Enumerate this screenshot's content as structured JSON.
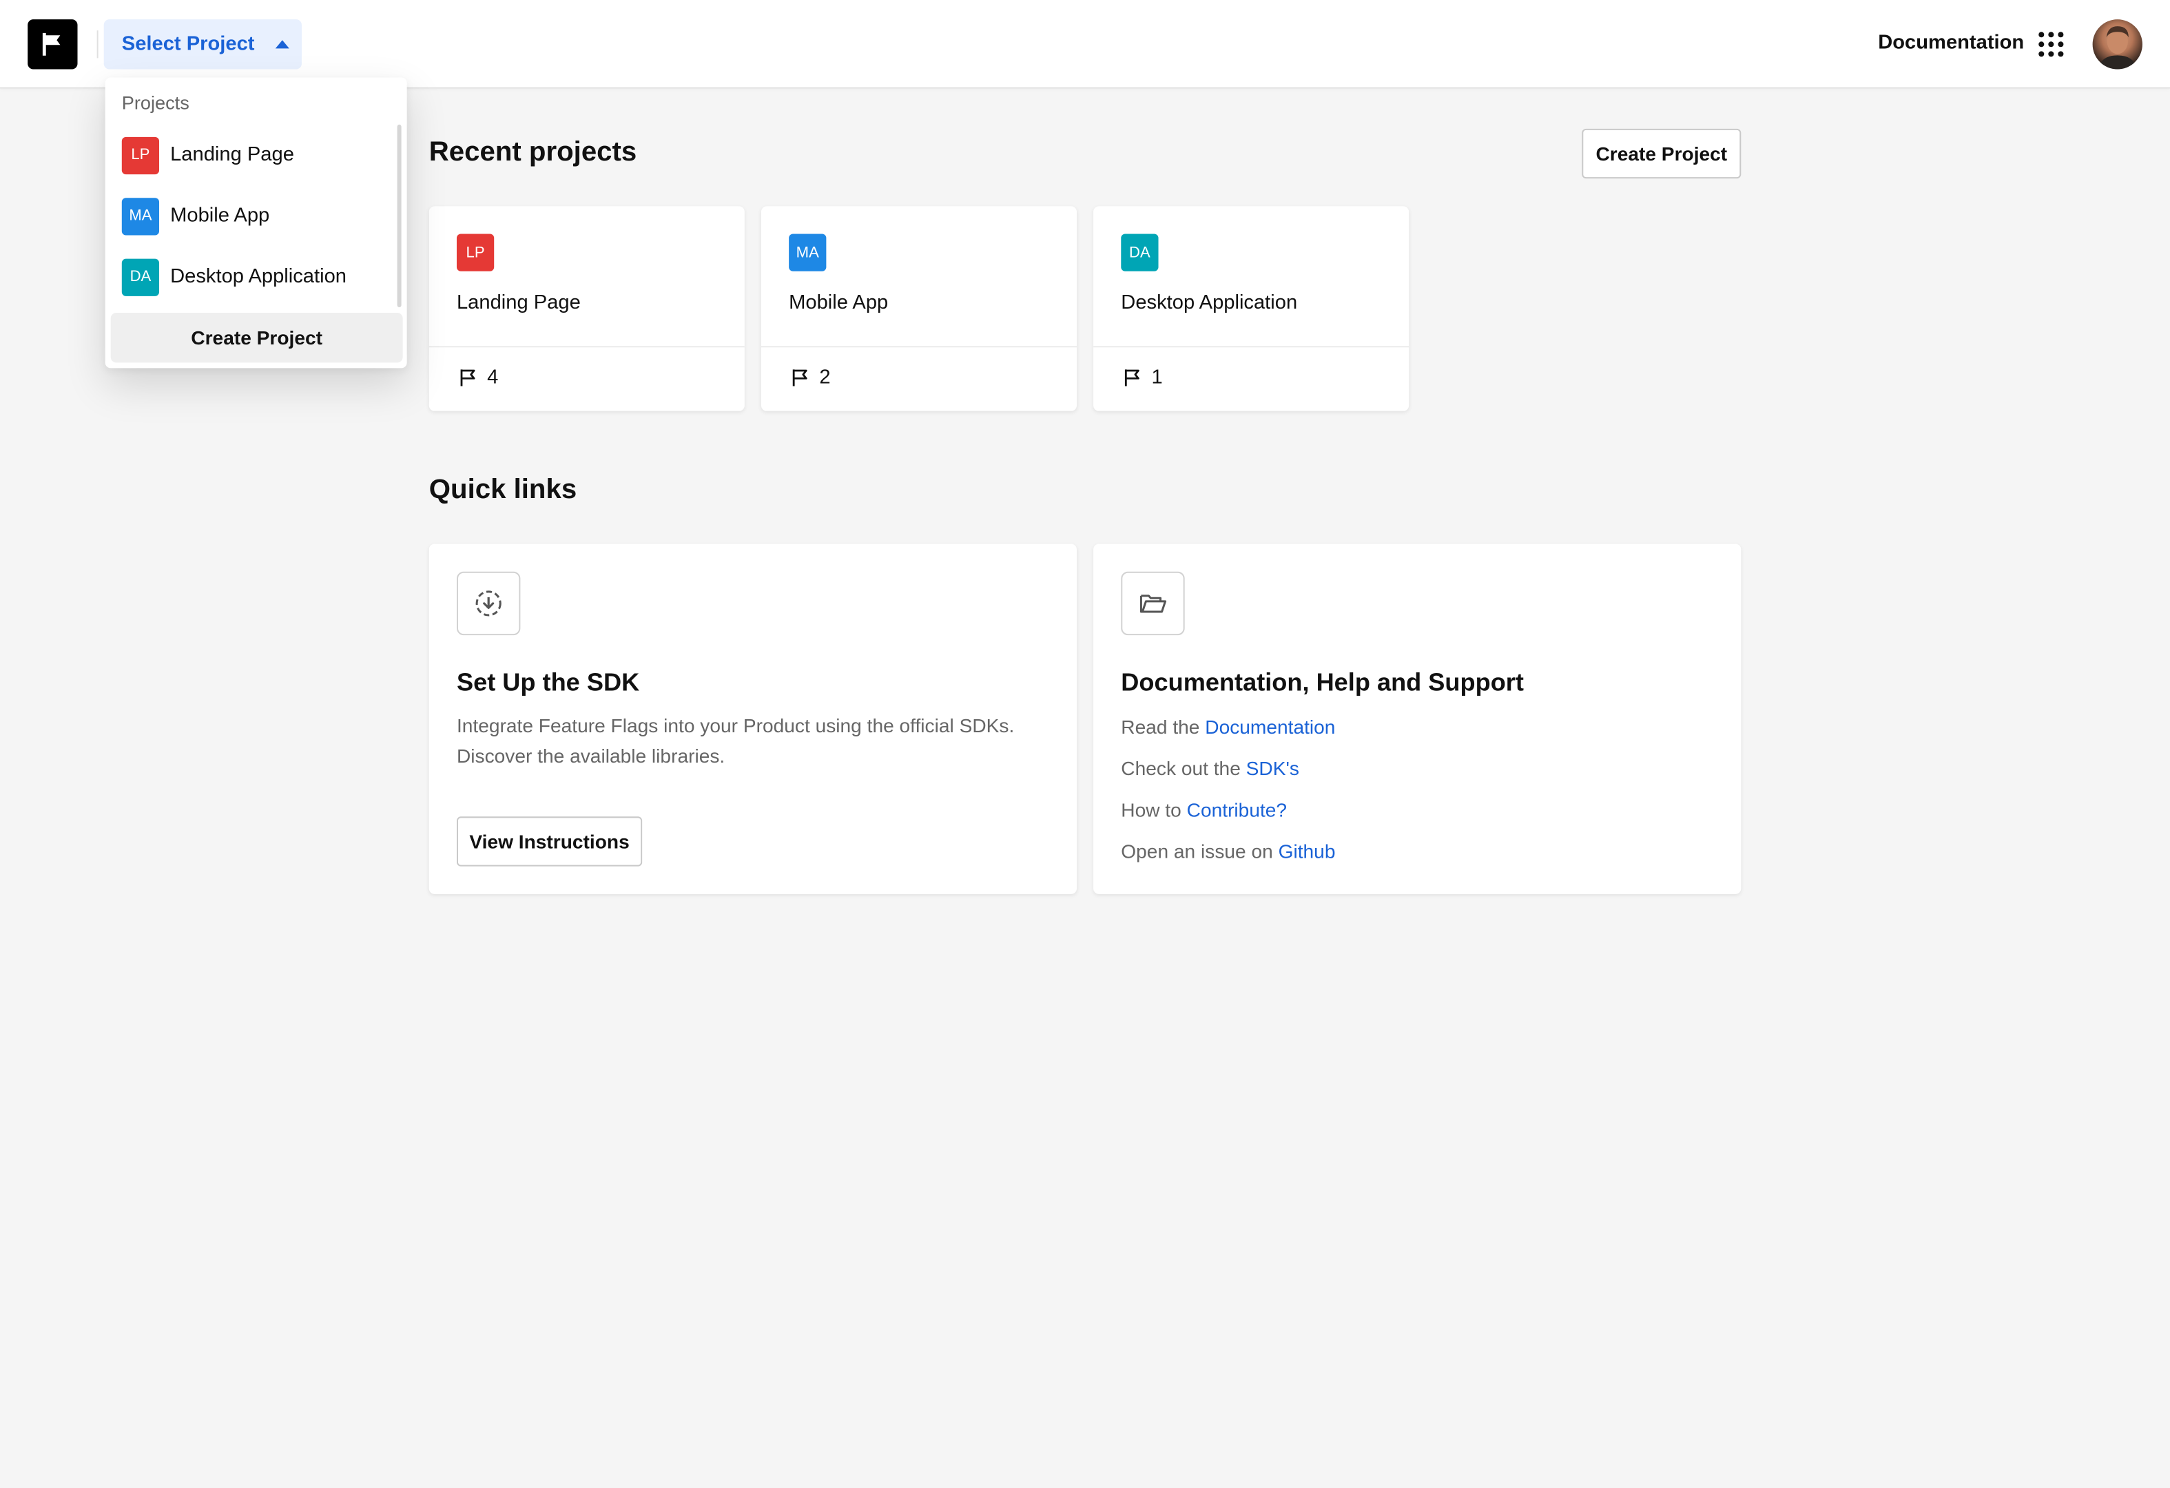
{
  "header": {
    "logo_icon": "flag-logo-icon",
    "project_selector_label": "Select Project",
    "documentation_label": "Documentation",
    "apps_icon": "apps-grid-icon",
    "avatar_icon": "user-avatar"
  },
  "dropdown": {
    "title": "Projects",
    "items": [
      {
        "initials": "LP",
        "label": "Landing Page",
        "color": "#e53935"
      },
      {
        "initials": "MA",
        "label": "Mobile App",
        "color": "#1e88e5"
      },
      {
        "initials": "DA",
        "label": "Desktop Application",
        "color": "#00a5b5"
      }
    ],
    "create_label": "Create Project"
  },
  "recent": {
    "heading": "Recent projects",
    "create_button": "Create Project",
    "projects": [
      {
        "initials": "LP",
        "name": "Landing Page",
        "flags": "4",
        "color": "#e53935"
      },
      {
        "initials": "MA",
        "name": "Mobile App",
        "flags": "2",
        "color": "#1e88e5"
      },
      {
        "initials": "DA",
        "name": "Desktop Application",
        "flags": "1",
        "color": "#00a5b5"
      }
    ]
  },
  "quick_links": {
    "heading": "Quick links",
    "sdk": {
      "icon": "download-circle-icon",
      "title": "Set Up the SDK",
      "desc_line1": "Integrate Feature Flags into your Product using the official SDKs.",
      "desc_line2": "Discover the available libraries.",
      "button": "View Instructions"
    },
    "help": {
      "icon": "folder-open-icon",
      "title": "Documentation, Help and Support",
      "lines": [
        {
          "prefix": "Read the ",
          "link": "Documentation"
        },
        {
          "prefix": "Check out the ",
          "link": "SDK's"
        },
        {
          "prefix": "How to ",
          "link": "Contribute?"
        },
        {
          "prefix": "Open an issue on ",
          "link": "Github"
        }
      ]
    }
  },
  "colors": {
    "accent": "#1a62d6",
    "background": "#f5f5f5"
  }
}
